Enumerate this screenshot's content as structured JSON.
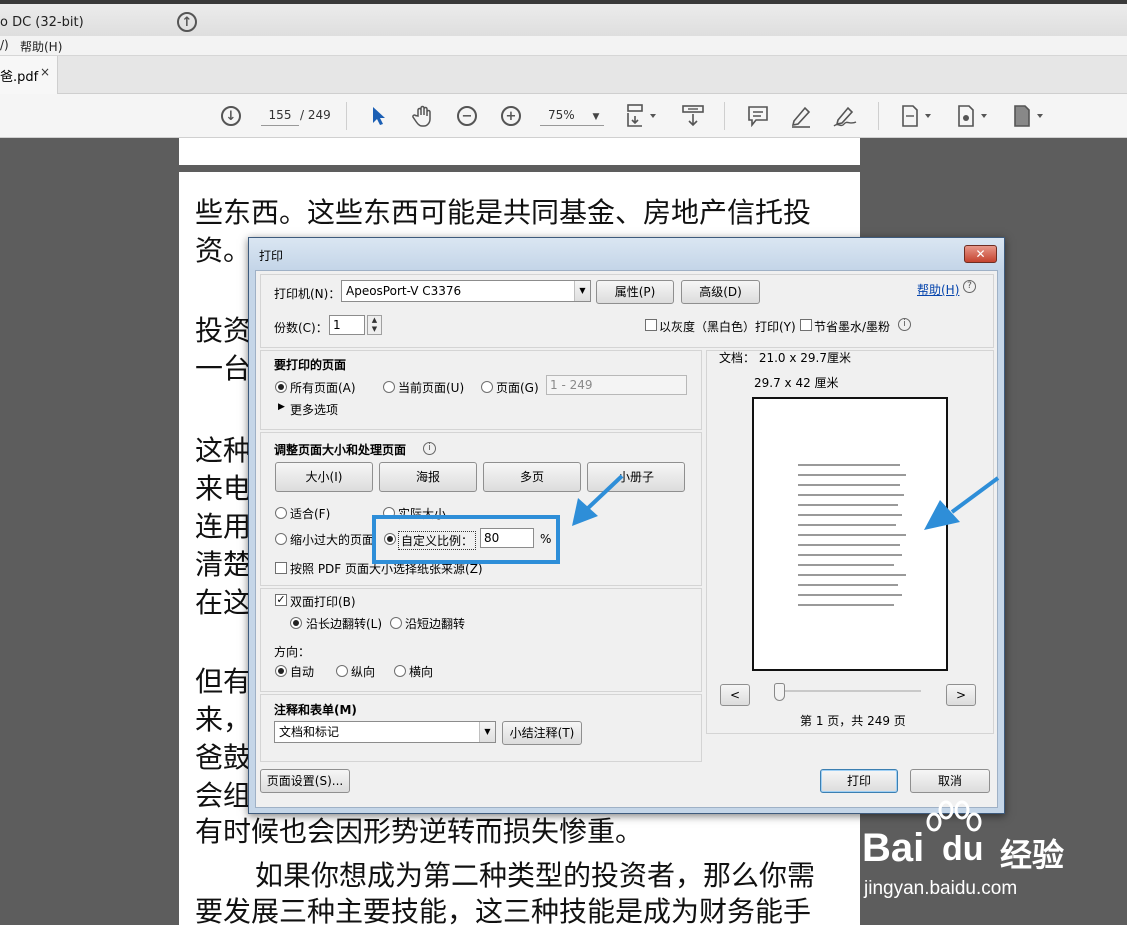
{
  "window": {
    "title": "o DC (32-bit)"
  },
  "menu": {
    "item1": "/)",
    "help": "帮助(H)"
  },
  "tab": {
    "label": "爸.pdf",
    "close": "×"
  },
  "toolbar": {
    "page_current": "155",
    "page_total": "/ 249",
    "zoom": "75%"
  },
  "document": {
    "lines": [
      "些东西。这些东西可能是共同基金、房地产信托投",
      "资。",
      "投资",
      "一台",
      "这种",
      "来电",
      "连用",
      "清楚",
      "在这",
      "但有",
      "来，",
      "爸鼓",
      "会组",
      "有时候也会因形势逆转而损失惨重。",
      "如果你想成为第二种类型的投资者，那么你需",
      "要发展三种主要技能，这三种技能是成为财务能手"
    ]
  },
  "dialog": {
    "title": "打印",
    "close": "✕",
    "printer_label": "打印机(N)：",
    "printer_value": "ApeosPort-V C3376",
    "properties_button": "属性(P)",
    "advanced_button": "高级(D)",
    "help_link": "帮助(H)",
    "copies_label": "份数(C)：",
    "copies_value": "1",
    "grayscale_label": "以灰度（黑白色）打印(Y)",
    "save_ink_label": "节省墨水/墨粉",
    "pages_section": {
      "title": "要打印的页面",
      "all": "所有页面(A)",
      "current": "当前页面(U)",
      "pages": "页面(G)",
      "pages_range": "1 - 249",
      "more": "更多选项"
    },
    "sizing_section": {
      "title": "调整页面大小和处理页面",
      "size": "大小(I)",
      "poster": "海报",
      "multiple": "多页",
      "booklet": "小册子",
      "fit": "适合(F)",
      "actual": "实际大小",
      "shrink": "缩小过大的页面",
      "custom": "自定义比例：",
      "custom_value": "80",
      "percent": "%",
      "pdf_source": "按照 PDF 页面大小选择纸张来源(Z)"
    },
    "duplex_section": {
      "duplex": "双面打印(B)",
      "long_edge": "沿长边翻转(L)",
      "short_edge": "沿短边翻转",
      "orientation": "方向：",
      "auto": "自动",
      "portrait": "纵向",
      "landscape": "横向"
    },
    "comments_section": {
      "title": "注释和表单(M)",
      "value": "文档和标记",
      "summarize_button": "小结注释(T)"
    },
    "preview": {
      "doc_size": "文档：  21.0 x 29.7厘米",
      "paper_size": "29.7 x 42 厘米",
      "page_info": "第 1 页，共 249 页",
      "prev": "<",
      "next": ">"
    },
    "page_setup_button": "页面设置(S)...",
    "print_button": "打印",
    "cancel_button": "取消"
  },
  "watermark": {
    "brand": "Bai",
    "du": "du",
    "cn": "经验",
    "url": "jingyan.baidu.com"
  },
  "colors": {
    "highlight": "#2e8ed8",
    "dialog_frame": "#c5d6e8",
    "close_red": "#c5432f"
  },
  "icons": [
    "arrow-up-circle-icon",
    "arrow-down-circle-icon",
    "select-arrow-icon",
    "hand-icon",
    "zoom-out-icon",
    "zoom-in-icon",
    "fit-page-icon",
    "scroll-mode-icon",
    "comment-icon",
    "highlight-pen-icon",
    "sign-icon",
    "page-icon",
    "page-edit-icon",
    "page-export-icon"
  ]
}
